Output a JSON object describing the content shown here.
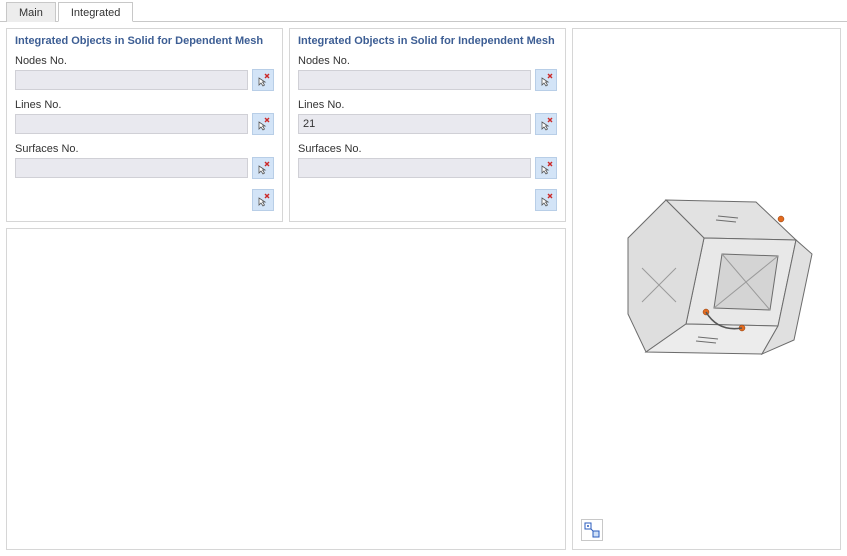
{
  "tabs": {
    "main": "Main",
    "integrated": "Integrated",
    "active": "integrated"
  },
  "dep": {
    "title": "Integrated Objects in Solid for Dependent Mesh",
    "nodes_label": "Nodes No.",
    "nodes_value": "",
    "lines_label": "Lines No.",
    "lines_value": "",
    "surfaces_label": "Surfaces No.",
    "surfaces_value": ""
  },
  "indep": {
    "title": "Integrated Objects in Solid for Independent Mesh",
    "nodes_label": "Nodes No.",
    "nodes_value": "",
    "lines_label": "Lines No.",
    "lines_value": "21",
    "surfaces_label": "Surfaces No.",
    "surfaces_value": ""
  },
  "icons": {
    "pick_cursor": "pick-cursor-icon",
    "clear_all": "clear-pick-icon",
    "view_toggle": "rubber-band-view-icon"
  },
  "colors": {
    "panel_title": "#3d5e94",
    "pick_bg": "#d3e4f7",
    "input_bg": "#e9e9ef"
  }
}
